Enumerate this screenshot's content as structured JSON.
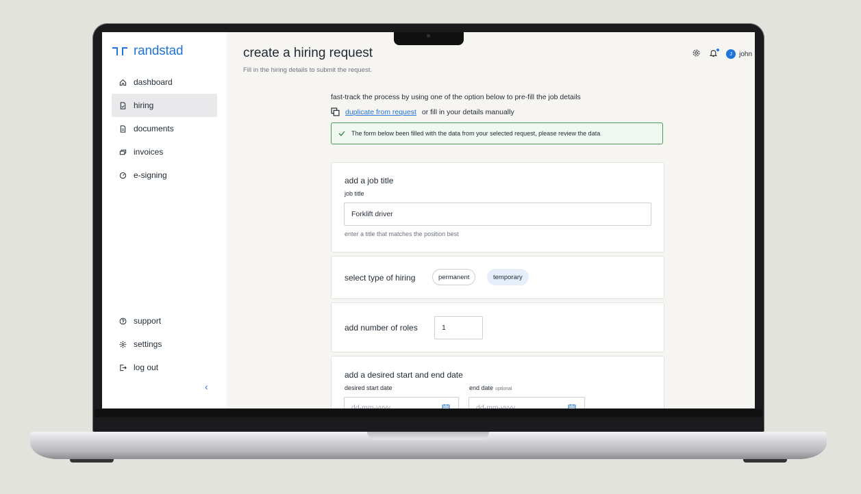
{
  "app": {
    "brand": "randstad"
  },
  "header": {
    "title": "create a hiring request",
    "subtitle": "Fill in the hiring details to submit the request.",
    "user_initial": "J",
    "user_name": "john"
  },
  "sidebar": {
    "items": [
      {
        "label": "dashboard",
        "icon": "home-icon"
      },
      {
        "label": "hiring",
        "icon": "document-check-icon",
        "active": true
      },
      {
        "label": "documents",
        "icon": "document-icon"
      },
      {
        "label": "invoices",
        "icon": "invoice-icon"
      },
      {
        "label": "e-signing",
        "icon": "signature-icon"
      }
    ],
    "bottom_items": [
      {
        "label": "support",
        "icon": "help-icon"
      },
      {
        "label": "settings",
        "icon": "gear-icon"
      },
      {
        "label": "log out",
        "icon": "logout-icon"
      }
    ],
    "collapse_glyph": "‹"
  },
  "prefill": {
    "intro": "fast-track the process by using one of the option below to pre-fill the job details",
    "duplicate_link": "duplicate from request",
    "manual_text": "or fill in your details manually",
    "alert": "The form below been filled with the data from your selected request, please review the data"
  },
  "job_title": {
    "heading": "add a job title",
    "label": "job title",
    "value": "Forklift driver",
    "hint": "enter a title that matches the position best"
  },
  "hiring_type": {
    "heading": "select type of hiring",
    "options": [
      "permanent",
      "temporary"
    ],
    "selected": "temporary"
  },
  "roles": {
    "heading": "add number of roles",
    "value": "1"
  },
  "dates": {
    "heading": "add a desired start and end date",
    "start_label": "desired start date",
    "end_label": "end date",
    "end_optional": "optional",
    "start_placeholder": "dd-mm-yyyy",
    "end_placeholder": "dd-mm-yyyy"
  },
  "colors": {
    "accent": "#2175d9",
    "success": "#4a9a5a"
  }
}
